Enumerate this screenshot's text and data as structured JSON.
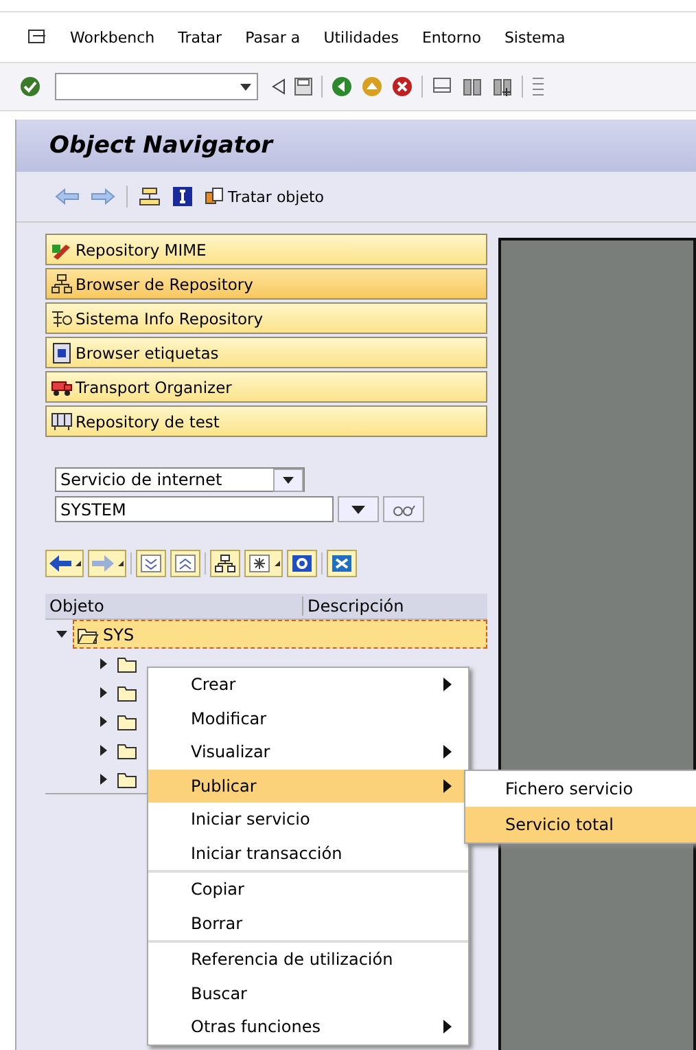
{
  "menu_bar": {
    "items": [
      "Workbench",
      "Tratar",
      "Pasar a",
      "Utilidades",
      "Entorno",
      "Sistema"
    ]
  },
  "title": "Object Navigator",
  "app_toolbar": {
    "button": "Tratar objeto"
  },
  "navigation": [
    {
      "label": "Repository MIME",
      "selected": false
    },
    {
      "label": "Browser de Repository",
      "selected": true
    },
    {
      "label": "Sistema Info Repository",
      "selected": false
    },
    {
      "label": "Browser etiquetas",
      "selected": false
    },
    {
      "label": "Transport Organizer",
      "selected": false
    },
    {
      "label": "Repository de test",
      "selected": false
    }
  ],
  "object_type": {
    "value": "Servicio de internet"
  },
  "object_name": {
    "value": "SYSTEM"
  },
  "tree": {
    "columns": [
      "Objeto",
      "Descripción"
    ],
    "nodes": [
      {
        "label": "SYS",
        "expanded": true,
        "selected": true,
        "children": [
          {
            "expanded": false
          },
          {
            "expanded": false
          },
          {
            "expanded": false
          },
          {
            "expanded": false
          },
          {
            "expanded": false
          }
        ]
      }
    ]
  },
  "context_menu": {
    "groups": [
      [
        {
          "label": "Crear",
          "submenu": true,
          "selected": false
        },
        {
          "label": "Modificar",
          "submenu": false,
          "selected": false
        },
        {
          "label": "Visualizar",
          "submenu": true,
          "selected": false
        },
        {
          "label": "Publicar",
          "submenu": true,
          "selected": true
        },
        {
          "label": "Iniciar servicio",
          "submenu": false,
          "selected": false
        },
        {
          "label": "Iniciar transacción",
          "submenu": false,
          "selected": false
        }
      ],
      [
        {
          "label": "Copiar",
          "submenu": false,
          "selected": false
        },
        {
          "label": "Borrar",
          "submenu": false,
          "selected": false
        }
      ],
      [
        {
          "label": "Referencia de utilización",
          "submenu": false,
          "selected": false
        },
        {
          "label": "Buscar",
          "submenu": false,
          "selected": false
        },
        {
          "label": "Otras funciones",
          "submenu": true,
          "selected": false
        }
      ]
    ]
  },
  "submenu": {
    "items": [
      {
        "label": "Fichero servicio",
        "selected": false
      },
      {
        "label": "Servicio total",
        "selected": true
      }
    ]
  }
}
